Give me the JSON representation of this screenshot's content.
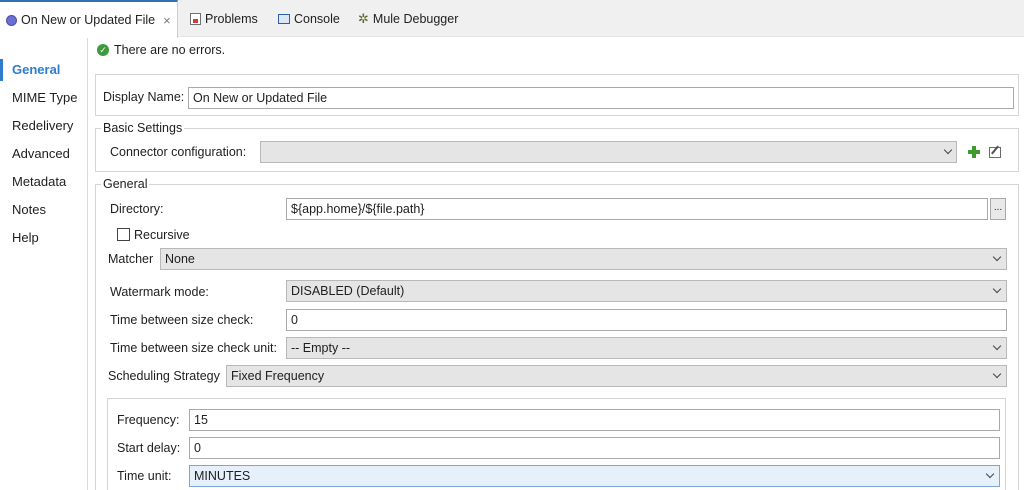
{
  "tabs": [
    {
      "label": "On New or Updated File",
      "icon": "flow-icon",
      "active": true
    },
    {
      "label": "Problems",
      "icon": "problems-icon"
    },
    {
      "label": "Console",
      "icon": "console-icon"
    },
    {
      "label": "Mule Debugger",
      "icon": "debugger-icon"
    }
  ],
  "tab_close_glyph": "×",
  "sidenav": [
    "General",
    "MIME Type",
    "Redelivery",
    "Advanced",
    "Metadata",
    "Notes",
    "Help"
  ],
  "status": {
    "message": "There are no errors.",
    "icon": "ok-check-icon"
  },
  "display_name": {
    "label": "Display Name:",
    "value": "On New or Updated File"
  },
  "basic_settings": {
    "title": "Basic Settings",
    "connector_label": "Connector configuration:",
    "connector_value": ""
  },
  "general": {
    "title": "General",
    "directory_label": "Directory:",
    "directory_value": "${app.home}/${file.path}",
    "browse_label": "...",
    "recursive_label": "Recursive",
    "recursive_checked": false,
    "matcher_label": "Matcher",
    "matcher_value": "None",
    "watermark_label": "Watermark mode:",
    "watermark_value": "DISABLED (Default)",
    "size_check_label": "Time between size check:",
    "size_check_value": "0",
    "size_check_unit_label": "Time between size check unit:",
    "size_check_unit_value": "-- Empty --",
    "scheduling_label": "Scheduling Strategy",
    "scheduling_value": "Fixed Frequency"
  },
  "schedule": {
    "frequency_label": "Frequency:",
    "frequency_value": "15",
    "start_delay_label": "Start delay:",
    "start_delay_value": "0",
    "time_unit_label": "Time unit:",
    "time_unit_value": "MINUTES"
  },
  "colors": {
    "accent": "#2f7bd0",
    "ok": "#3c9b3c",
    "add": "#3f9b2f"
  }
}
